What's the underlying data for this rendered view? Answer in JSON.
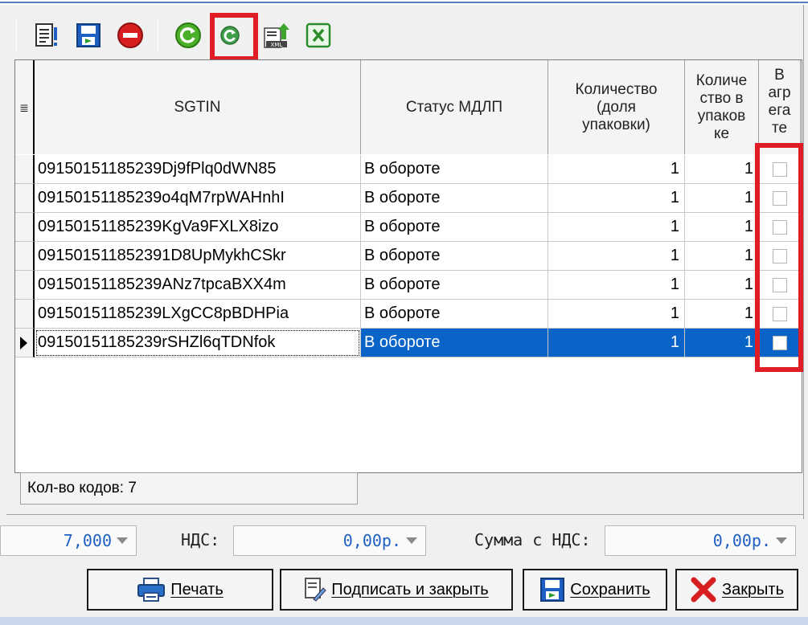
{
  "toolbar": {
    "buttons": [
      {
        "name": "properties",
        "icon": "document-list-icon"
      },
      {
        "name": "save",
        "icon": "save-icon"
      },
      {
        "name": "cancel",
        "icon": "stop-icon"
      },
      {
        "name": "refresh",
        "icon": "refresh-green-icon"
      },
      {
        "name": "refresh-small",
        "icon": "refresh-small-icon",
        "highlighted": true
      },
      {
        "name": "export-xml",
        "icon": "xml-export-icon"
      },
      {
        "name": "export-excel",
        "icon": "excel-icon"
      }
    ]
  },
  "grid": {
    "columns": {
      "sgtin": "SGTIN",
      "status": "Статус МДЛП",
      "qty_fraction": "Количество (доля упаковки)",
      "qty_in_pack": "Количе ство в упаков ке",
      "in_aggregate": "В агр ега те"
    },
    "rows": [
      {
        "sgtin": "09150151185239Dj9fPlq0dWN85",
        "status": "В обороте",
        "qty_fraction": "1",
        "qty_in_pack": "1",
        "in_aggregate": false
      },
      {
        "sgtin": "09150151185239o4qM7rpWAHnhI",
        "status": "В обороте",
        "qty_fraction": "1",
        "qty_in_pack": "1",
        "in_aggregate": false
      },
      {
        "sgtin": "09150151185239KgVa9FXLX8izo",
        "status": "В обороте",
        "qty_fraction": "1",
        "qty_in_pack": "1",
        "in_aggregate": false
      },
      {
        "sgtin": "091501511852391D8UpMykhCSkr",
        "status": "В обороте",
        "qty_fraction": "1",
        "qty_in_pack": "1",
        "in_aggregate": false
      },
      {
        "sgtin": "09150151185239ANz7tpcaBXX4m",
        "status": "В обороте",
        "qty_fraction": "1",
        "qty_in_pack": "1",
        "in_aggregate": false
      },
      {
        "sgtin": "09150151185239LXgCC8pBDHPia",
        "status": "В обороте",
        "qty_fraction": "1",
        "qty_in_pack": "1",
        "in_aggregate": false
      },
      {
        "sgtin": "09150151185239rSHZl6qTDNfok",
        "status": "В обороте",
        "qty_fraction": "1",
        "qty_in_pack": "1",
        "in_aggregate": false,
        "selected": true
      }
    ],
    "code_count": "Кол-во кодов: 7"
  },
  "totals": {
    "quantity_value": "7,000",
    "vat_label": "НДС:",
    "vat_value": "0,00р.",
    "sum_label": "Сумма с НДС:",
    "sum_value": "0,00р."
  },
  "buttons": {
    "print": "Печать",
    "sign_close": "Подписать и закрыть",
    "save": "Сохранить",
    "close": "Закрыть"
  },
  "colors": {
    "selection": "#0a64c8",
    "highlight": "#e01c24",
    "value_text": "#1e5fc4"
  }
}
